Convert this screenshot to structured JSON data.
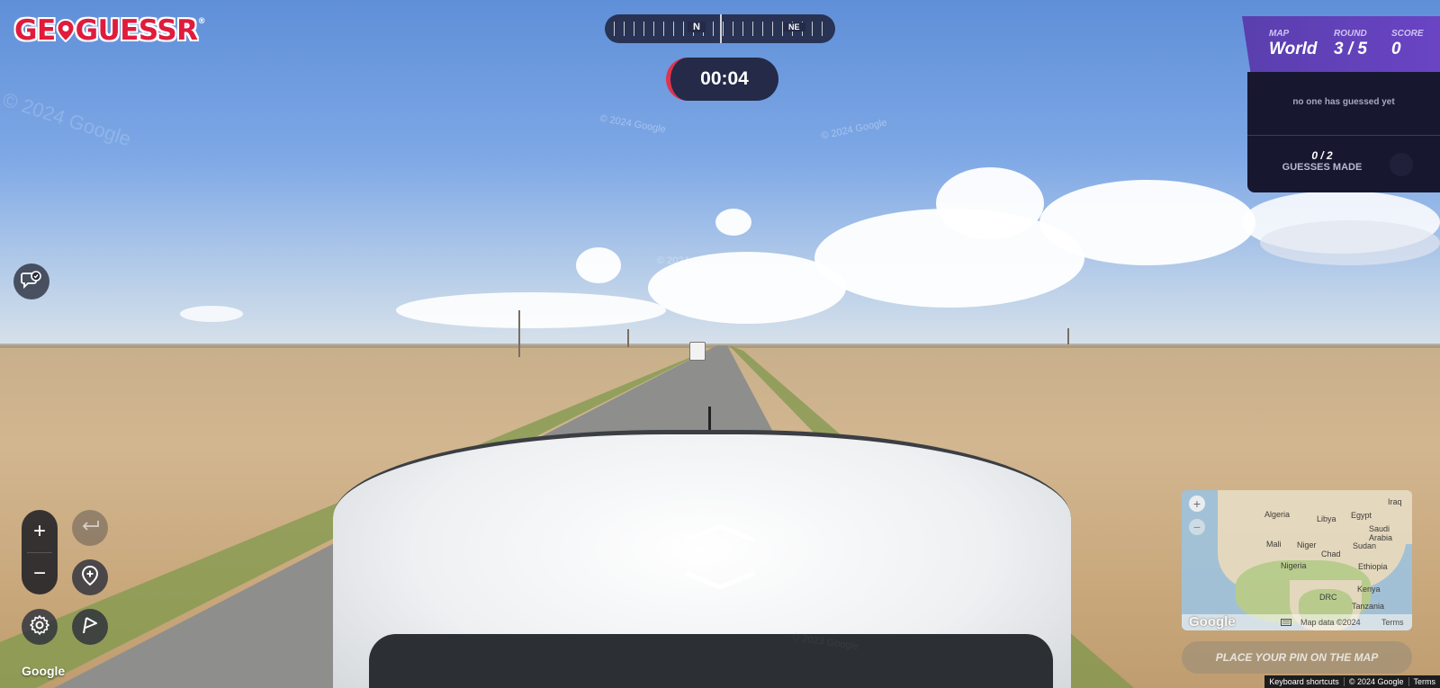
{
  "logo": {
    "text_before": "GE",
    "text_after": "GUESSR",
    "registered": "®"
  },
  "compass": {
    "north": "N",
    "northeast": "NE"
  },
  "timer": {
    "value": "00:04"
  },
  "scoreboard": {
    "map_label": "MAP",
    "map_value": "World",
    "round_label": "ROUND",
    "round_value": "3 / 5",
    "score_label": "SCORE",
    "score_value": "0",
    "guess_status": "no one has guessed yet",
    "guesses_count": "0 / 2",
    "guesses_label": "GUESSES MADE"
  },
  "watermarks": {
    "wm1": "© 2024 Google",
    "wm2": "© 2024 Google",
    "wm3": "© 2024 Google",
    "wm4": "© 2024 Google",
    "wm5": "© 2023 Google"
  },
  "controls": {
    "zoom_in": "+",
    "zoom_out": "−"
  },
  "google_logo": "Google",
  "minimap": {
    "labels": [
      "Algeria",
      "Libya",
      "Egypt",
      "Iraq",
      "Saudi Arabia",
      "Mali",
      "Niger",
      "Chad",
      "Sudan",
      "Nigeria",
      "Ethiopia",
      "DRC",
      "Kenya",
      "Tanzania"
    ],
    "google": "Google",
    "map_data": "Map data ©2024",
    "terms": "Terms",
    "zoom_in": "+",
    "zoom_out": "−"
  },
  "place_pin_label": "PLACE YOUR PIN ON THE MAP",
  "footer": {
    "shortcuts": "Keyboard shortcuts",
    "copyright": "© 2024 Google",
    "terms": "Terms"
  },
  "icons": {
    "chat": "chat-icon",
    "undo": "undo-icon",
    "add_pin": "add-location-icon",
    "settings": "gear-icon",
    "flag": "flag-icon",
    "keyboard": "keyboard-icon"
  },
  "colors": {
    "brand_red": "#e01b3c",
    "panel_dark": "#171730",
    "header_purple": "#5a3fae",
    "timer_bg": "#242a48",
    "timer_accent": "#e0334d"
  }
}
